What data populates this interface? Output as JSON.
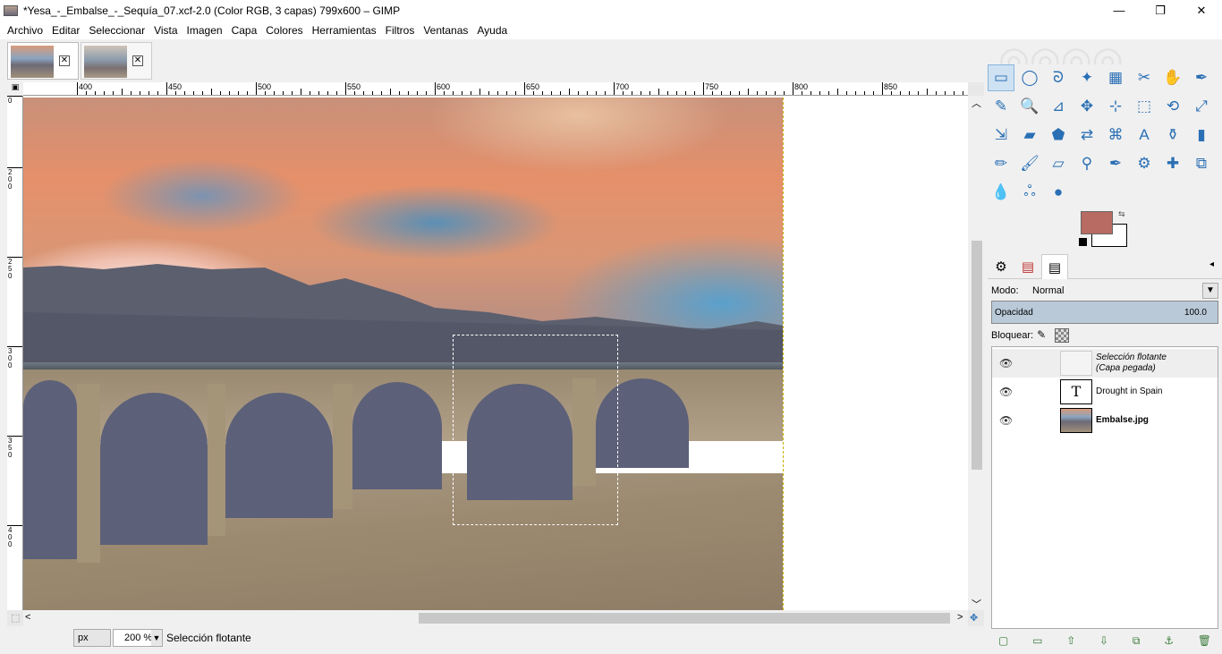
{
  "window": {
    "title": "*Yesa_-_Embalse_-_Sequía_07.xcf-2.0 (Color RGB, 3 capas) 799x600 – GIMP",
    "controls": [
      "—",
      "❐",
      "✕"
    ]
  },
  "menu": [
    "Archivo",
    "Editar",
    "Seleccionar",
    "Vista",
    "Imagen",
    "Capa",
    "Colores",
    "Herramientas",
    "Filtros",
    "Ventanas",
    "Ayuda"
  ],
  "image_tabs": [
    {
      "close": "✕"
    },
    {
      "close": "✕"
    }
  ],
  "ruler": {
    "top": [
      "400",
      "450",
      "500",
      "550",
      "600",
      "650",
      "700",
      "750",
      "800",
      "850"
    ],
    "left": [
      "0",
      "200",
      "250",
      "300",
      "350",
      "400"
    ]
  },
  "statusbar": {
    "unit": "px",
    "zoom": "200 %",
    "message": "Selección flotante"
  },
  "toolbox": {
    "tools": [
      "rect-select-icon",
      "ellipse-select-icon",
      "lasso-icon",
      "fuzzy-select-icon",
      "color-select-icon",
      "scissors-icon",
      "foreground-select-icon",
      "paths-icon",
      "color-picker-icon",
      "zoom-icon",
      "measure-icon",
      "move-icon",
      "align-icon",
      "crop-icon",
      "unified-transform-icon",
      "rotate-icon",
      "scale-icon",
      "shear-icon",
      "perspective-icon",
      "flip-icon",
      "cage-icon",
      "text-icon",
      "bucket-fill-icon",
      "gradient-icon",
      "pencil-icon",
      "paintbrush-icon",
      "eraser-icon",
      "airbrush-icon",
      "ink-icon",
      "clone-icon",
      "heal-icon",
      "perspective-clone-icon",
      "blur-icon",
      "smudge-icon",
      "dodge-burn-icon"
    ],
    "glyphs": [
      "▭",
      "◯",
      "ᘐ",
      "✦",
      "▦",
      "✂",
      "✋",
      "✒",
      "✎",
      "🔍",
      "⊿",
      "✥",
      "⊹",
      "⬚",
      "⟲",
      "⤢",
      "⇲",
      "▰",
      "⬟",
      "⇄",
      "⌘",
      "A",
      "⚱",
      "▮",
      "✏",
      "🖌",
      "▱",
      "⚲",
      "✒",
      "⚙",
      "✚",
      "⧉",
      "💧",
      "ஃ",
      "●"
    ],
    "fg_color": "#b86b62",
    "bg_color": "#ffffff"
  },
  "dock": {
    "tabs": [
      "tool-options-icon",
      "channels-icon",
      "layers-icon"
    ],
    "mode_label": "Modo:",
    "mode_value": "Normal",
    "opacity_label": "Opacidad",
    "opacity_value": "100.0",
    "lock_label": "Bloquear:",
    "layers": [
      {
        "name": "Selección flotante",
        "sub": "(Capa pegada)",
        "style": "italic"
      },
      {
        "name": "Drought in Spain",
        "sub": "",
        "style": "normal"
      },
      {
        "name": "Embalse.jpg",
        "sub": "",
        "style": "bold"
      }
    ],
    "footer": [
      "new-layer-icon",
      "new-group-icon",
      "raise-icon",
      "lower-icon",
      "duplicate-icon",
      "anchor-icon",
      "delete-icon"
    ]
  }
}
